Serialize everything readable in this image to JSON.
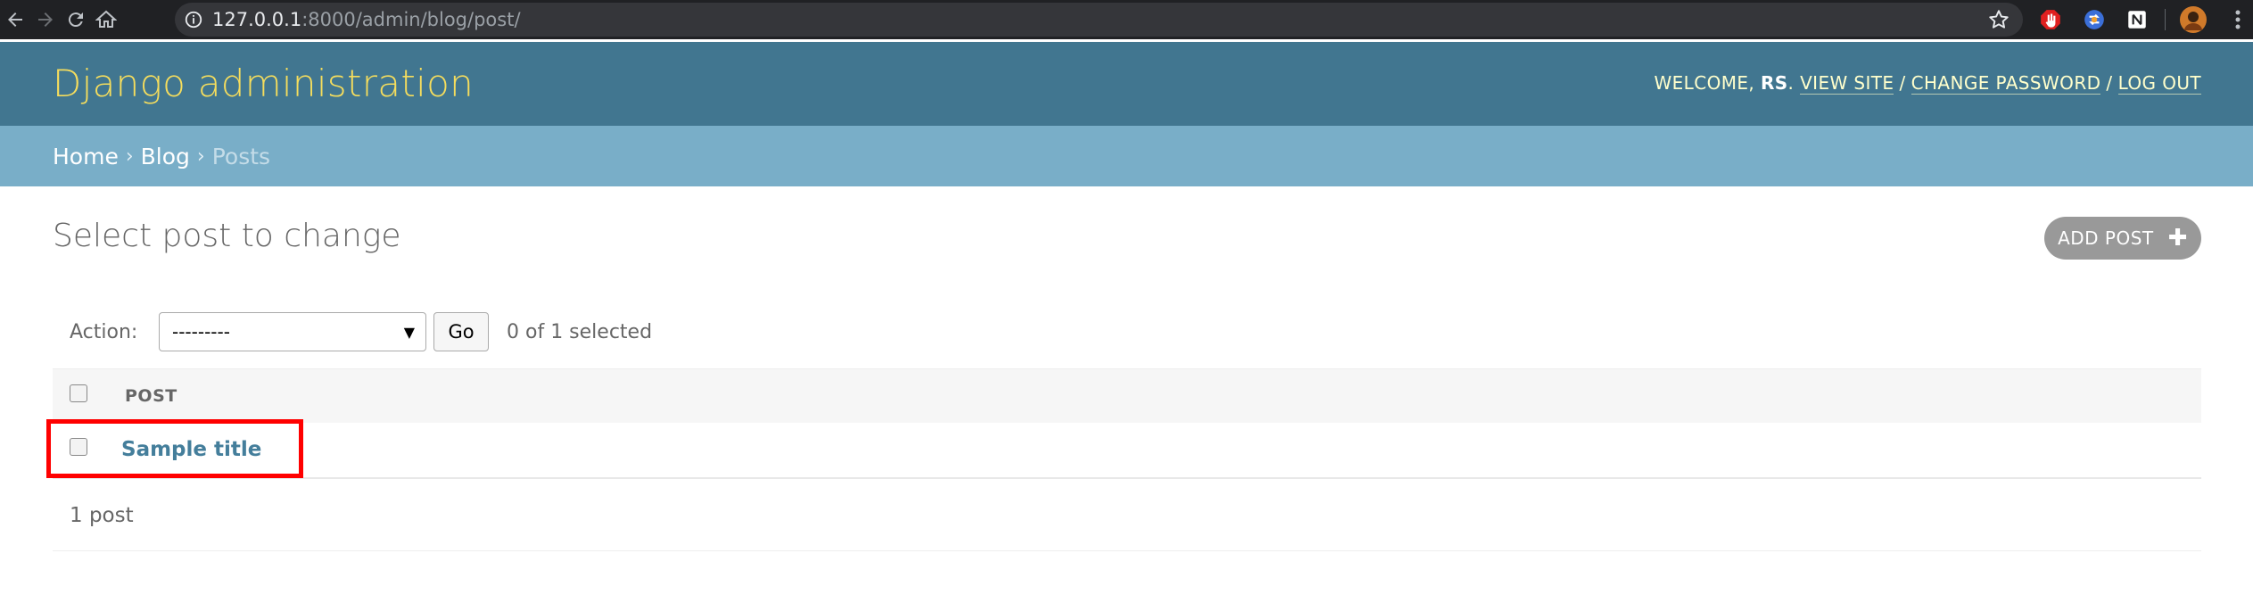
{
  "browser": {
    "url_host": "127.0.0.1",
    "url_rest": ":8000/admin/blog/post/"
  },
  "header": {
    "site_title": "Django administration",
    "welcome": "WELCOME, ",
    "username": "RS",
    "view_site": "VIEW SITE",
    "change_password": "CHANGE PASSWORD",
    "log_out": "LOG OUT"
  },
  "breadcrumbs": {
    "home": "Home",
    "app": "Blog",
    "current": "Posts",
    "separator": "›"
  },
  "content": {
    "title": "Select post to change",
    "add_button": "ADD POST"
  },
  "actions": {
    "label": "Action:",
    "selected_option": "---------",
    "go": "Go",
    "selected_count": "0 of 1 selected"
  },
  "table": {
    "columns": [
      "POST"
    ],
    "rows": [
      {
        "post": "Sample title"
      }
    ]
  },
  "paginator": {
    "count": "1 post"
  },
  "colors": {
    "header_bg": "#417690",
    "breadcrumb_bg": "#79aec8",
    "brand": "#f5dd5d",
    "link": "#447e9b",
    "highlight": "#ff0000"
  },
  "icons": [
    "back-icon",
    "forward-icon",
    "reload-icon",
    "home-icon",
    "info-icon",
    "star-icon",
    "adblock-icon",
    "sync-icon",
    "notion-icon",
    "profile-avatar",
    "menu-icon",
    "plus-icon",
    "dropdown-caret-icon"
  ]
}
